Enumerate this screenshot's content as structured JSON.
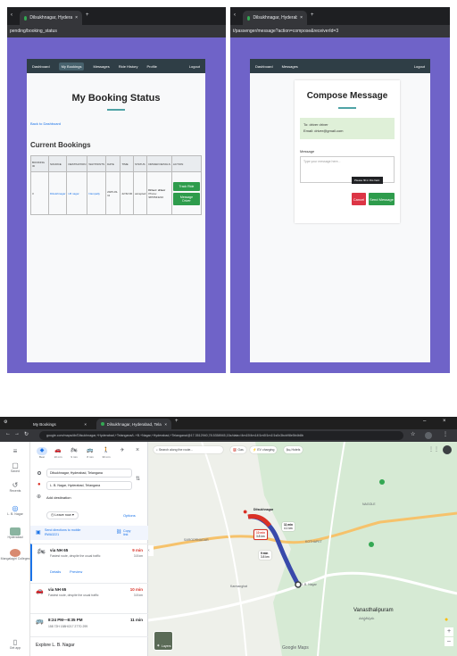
{
  "booking_window": {
    "tab_title": "Dilsukhnagar, Hyderabad, Tela...",
    "url": "pending/booking_status",
    "nav": [
      "Dashboard",
      "My Bookings",
      "Messages",
      "Ride History",
      "Profile"
    ],
    "logout": "Logout",
    "page_title": "My Booking Status",
    "back_link": "Back to Dashboard",
    "section_title": "Current Bookings",
    "table_headers": [
      "BOOKING ID",
      "SOURCE",
      "DESTINATION",
      "WAYPOINTS",
      "DATE",
      "TIME",
      "STATUS",
      "DRIVER DETAILS",
      "ACTION"
    ],
    "row": {
      "id": "3",
      "source": "Dilsukhnagar",
      "destination": "LB nagar",
      "waypoints": "Nampally",
      "date": "2025-03-11",
      "time": "22:52:00",
      "status": "accepted",
      "driver": "Driver: driver",
      "phone": "Phone: 9876543210",
      "actions": [
        "Track Ride",
        "Message Driver"
      ]
    }
  },
  "compose_window": {
    "tab_title": "Dilsukhnagar, Hyderabad, Tela...",
    "url": "t/passenger/message?action=compose&receiverId=3",
    "nav": [
      "Dashboard",
      "Messages"
    ],
    "logout": "Logout",
    "page_title": "Compose Message",
    "to": "To: driver driver",
    "email": "Email: driver@gmail.com",
    "message_label": "Message",
    "message_placeholder": "Type your message here...",
    "tooltip": "Please fill in this field.",
    "cancel": "Cancel",
    "send": "Send Message"
  },
  "maps_window": {
    "tabs": [
      "My Bookings",
      "Dilsukhnagar, Hyderabad, Telang..."
    ],
    "url": "google.com/maps/dir/Dilsukhnagar,+Hyderabad,+Telangana/L.+B.+Nagar,+Hyderabad,+Telangana/@17.3512940,78.5358945,15z/data=!4m15!4m14!1m5!1m1!1s0x3bcb98e5b4b8b",
    "rail": [
      "Saved",
      "Recents",
      "L. B. Nagar",
      "Hyderabad",
      "Mangalagiri Colleges",
      "Get app"
    ],
    "modes": [
      {
        "label": "Best",
        "icon": "◆"
      },
      {
        "label": "10 min",
        "icon": "🚗"
      },
      {
        "label": "9 min",
        "icon": "🏍"
      },
      {
        "label": "8 min",
        "icon": "🚌"
      },
      {
        "label": "30 min",
        "icon": "🚶"
      },
      {
        "label": "",
        "icon": "✈"
      }
    ],
    "origin": "Dilsukhnagar, Hyderabad, Telangana",
    "destination": "L. B. Nagar, Hyderabad, Telangana",
    "add_destination": "Add destination",
    "leave_now": "Leave now",
    "options": "Options",
    "send_directions": "Send directions to mobile",
    "send_code": "RWA3221",
    "copy_link": "Copy link",
    "routes": [
      {
        "via": "via NH 65",
        "desc": "Fastest route, despite the usual traffic",
        "time": "9 min",
        "dist": "3.8 km",
        "links": [
          "Details",
          "Preview"
        ]
      },
      {
        "via": "via NH 65",
        "desc": "Fastest route, despite the usual traffic",
        "time": "10 min",
        "dist": "3.8 km"
      }
    ],
    "transit": {
      "time": "8:24 PM—8:35 PM",
      "duration": "11 min",
      "lines": "158  72H  158H/217  277D  299"
    },
    "explore": "Explore L. B. Nagar",
    "search_placeholder": "Search along the route...",
    "chips": [
      "Gas",
      "EV charging",
      "Hotels"
    ],
    "places": {
      "dilsukhnagar": "Dilsukhnagar",
      "vanasthali": "Vanasthalipuram",
      "vanasthali_te": "వనస్థలిపురం",
      "nagole": "NAGOLE",
      "saroornagar": "SAROORNAGAR",
      "karmanghat": "Karmanghat",
      "kothapet": "KOTHAPET",
      "lb_nagar": "L.B. Nagar",
      "google": "Google Maps",
      "layers": "Layers"
    },
    "time_badges": [
      {
        "t": "10 min",
        "d": "3.8 km"
      },
      {
        "t": "11 min",
        "d": "4.1 km"
      },
      {
        "t": "9 min",
        "d": "3.8 km"
      }
    ]
  }
}
